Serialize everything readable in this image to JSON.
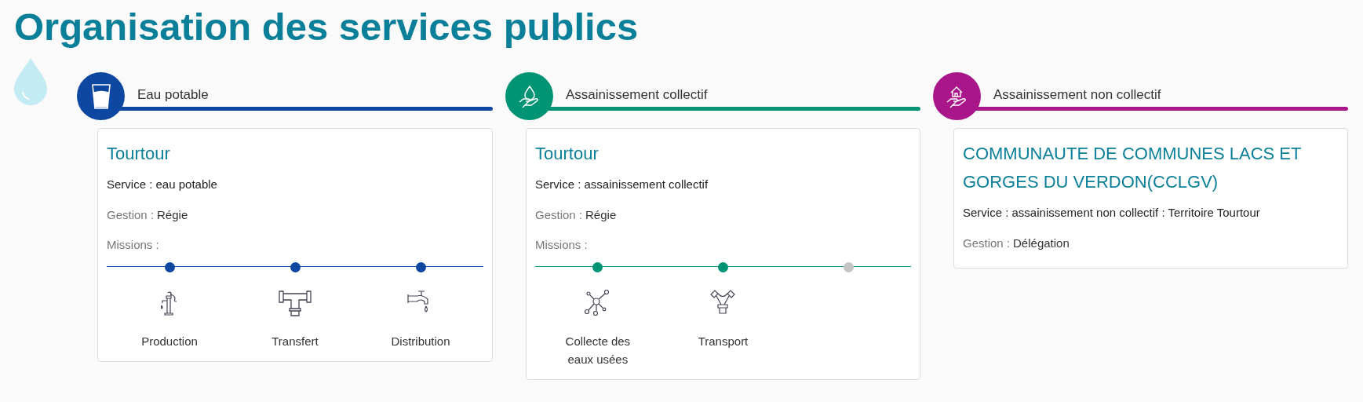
{
  "title": "Organisation des services publics",
  "sections": [
    {
      "label": "Eau potable",
      "color": "#0d47a1",
      "card": {
        "title": "Tourtour",
        "service": "Service : eau potable",
        "gestion_label": "Gestion :",
        "gestion_value": "Régie",
        "missions_label": "Missions :",
        "missions": [
          {
            "label": "Production",
            "kind": "production",
            "active": true
          },
          {
            "label": "Transfert",
            "kind": "transfer",
            "active": true
          },
          {
            "label": "Distribution",
            "kind": "distribution",
            "active": true
          }
        ]
      }
    },
    {
      "label": "Assainissement collectif",
      "color": "#009474",
      "card": {
        "title": "Tourtour",
        "service": "Service : assainissement collectif",
        "gestion_label": "Gestion :",
        "gestion_value": "Régie",
        "missions_label": "Missions :",
        "missions": [
          {
            "label": "Collecte des eaux usées",
            "kind": "collection",
            "active": true
          },
          {
            "label": "Transport",
            "kind": "transport",
            "active": true
          },
          {
            "active": false
          }
        ]
      }
    },
    {
      "label": "Assainissement non collectif",
      "color": "#a8168a",
      "card": {
        "title": "COMMUNAUTE DE COMMUNES LACS ET GORGES DU VERDON(CCLGV)",
        "service": "Service : assainissement non collectif : Territoire Tourtour",
        "gestion_label": "Gestion :",
        "gestion_value": "Délégation"
      }
    }
  ]
}
